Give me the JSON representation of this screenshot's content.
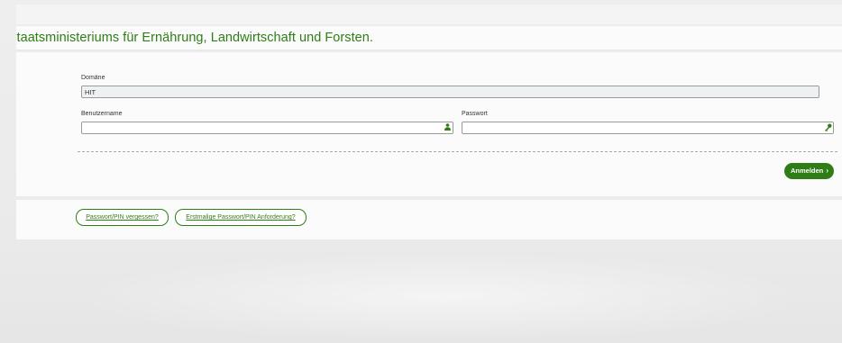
{
  "page": {
    "title_text": "hen Staatsministeriums für Ernährung, Landwirtschaft und Forsten."
  },
  "form": {
    "domain": {
      "label": "Domäne",
      "value": "HIT"
    },
    "username": {
      "label": "Benutzername",
      "value": "",
      "icon": "user-icon"
    },
    "password": {
      "label": "Passwort",
      "value": "",
      "icon": "key-icon"
    },
    "submit_label": "Anmelden",
    "submit_icon": "chevron-right-icon"
  },
  "links": {
    "forgot_password": "Passwort/PIN vergessen?",
    "first_request": "Erstmalige Passwort/PIN Anforderung?"
  },
  "colors": {
    "accent_green": "#2f7d17",
    "title_green": "#2e7d16"
  }
}
